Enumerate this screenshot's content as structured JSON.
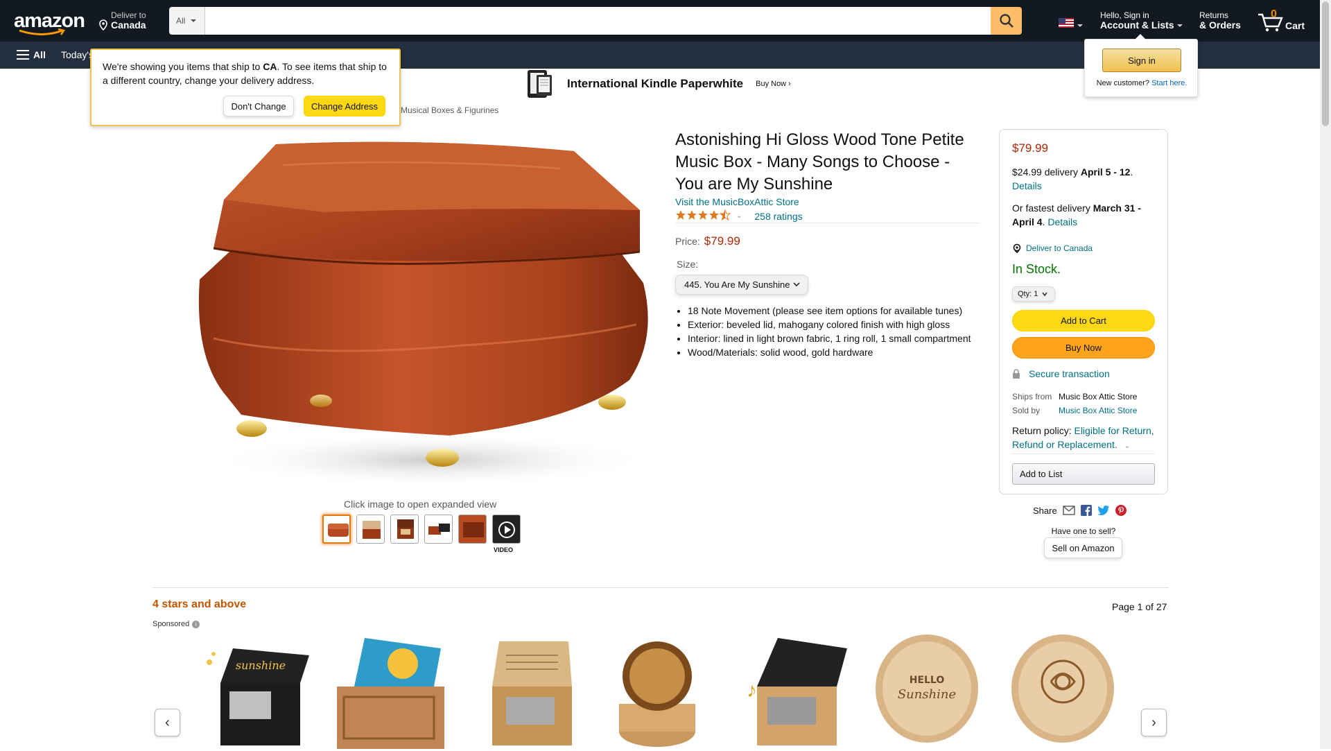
{
  "header": {
    "logo_text": "amazon",
    "deliver_line1": "Deliver to",
    "deliver_line2": "Canada",
    "search_category": "All",
    "search_placeholder": "",
    "account_line1": "Hello, Sign in",
    "account_line2": "Account & Lists",
    "returns_line1": "Returns",
    "returns_line2": "& Orders",
    "cart_count": "0",
    "cart_label": "Cart"
  },
  "subnav": {
    "all_label": "All",
    "today_label": "Today's"
  },
  "banner": {
    "title": "International Kindle Paperwhite",
    "buy": "Buy Now ›"
  },
  "delivery_popover": {
    "msg_part1": "We're showing you items that ship to ",
    "country": "CA",
    "msg_part2": ". To see items that ship to a different country, change your delivery address.",
    "dont_change": "Don't Change",
    "change_address": "Change Address"
  },
  "signin_popover": {
    "button": "Sign in",
    "new_customer": "New customer?",
    "start_here": "Start here."
  },
  "breadcrumb": "Musical Boxes & Figurines",
  "gallery": {
    "click_hint": "Click image to open expanded view",
    "video_label": "VIDEO"
  },
  "product": {
    "title": "Astonishing Hi Gloss Wood Tone Petite Music Box - Many Songs to Choose - You are My Sunshine",
    "store_link": "Visit the MusicBoxAttic Store",
    "rating_value": 4.5,
    "ratings_count": "258 ratings",
    "price_label": "Price:",
    "price": "$79.99",
    "size_label": "Size:",
    "size_selected": "445. You Are My Sunshine",
    "bullets": [
      "18 Note Movement (please see item options for available tunes)",
      "Exterior: beveled lid, mahogany colored finish with high gloss",
      "Interior: lined in light brown fabric, 1 ring roll, 1 small compartment",
      "Wood/Materials: solid wood, gold hardware"
    ]
  },
  "buybox": {
    "price": "$79.99",
    "delivery_fee": "$24.99 delivery ",
    "delivery_dates": "April 5 - 12",
    "details": "Details",
    "fastest_prefix": "Or fastest delivery ",
    "fastest_dates": "March 31 - April 4",
    "deliver_to": "Deliver to Canada",
    "stock": "In Stock.",
    "qty_label": "Qty:",
    "qty_value": "1",
    "add_to_cart": "Add to Cart",
    "buy_now": "Buy Now",
    "secure": "Secure transaction",
    "ships_from_label": "Ships from",
    "ships_from_value": "Music Box Attic Store",
    "sold_by_label": "Sold by",
    "sold_by_value": "Music Box Attic Store",
    "return_label": "Return policy: ",
    "return_value": "Eligible for Return, Refund or Replacement.",
    "add_to_list": "Add to List"
  },
  "share": {
    "label": "Share",
    "have_one": "Have one to sell?",
    "sell_button": "Sell on Amazon"
  },
  "carousel": {
    "heading": "4 stars and above",
    "page": "Page 1 of 27",
    "sponsored": "Sponsored",
    "items": [
      {
        "name": "you-are-my-sunshine-black-crank-box"
      },
      {
        "name": "you-are-my-sunshine-colorful-crank-box"
      },
      {
        "name": "daughter-engraved-crank-box"
      },
      {
        "name": "crystal-ball-music-box"
      },
      {
        "name": "music-note-carved-crank-box"
      },
      {
        "name": "hello-sunshine-round-box"
      },
      {
        "name": "rose-round-box"
      }
    ]
  },
  "colors": {
    "nav_dark": "#131921",
    "nav_sub": "#232f3e",
    "search_btn": "#febd69",
    "price": "#b12704",
    "link": "#007185",
    "in_stock": "#007600",
    "add_to_cart": "#ffd814",
    "buy_now": "#ffa41c",
    "carousel_heading": "#c45500"
  }
}
